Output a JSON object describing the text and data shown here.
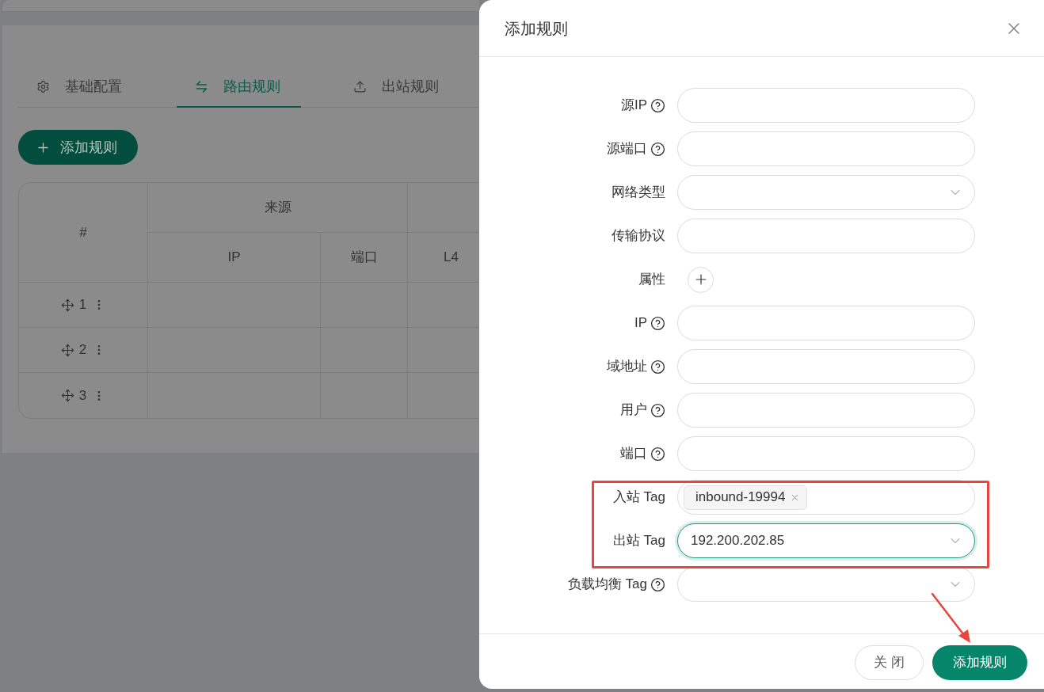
{
  "page": {
    "tabs": [
      {
        "label": "基础配置",
        "selected": false
      },
      {
        "label": "路由规则",
        "selected": true
      },
      {
        "label": "出站规则",
        "selected": false
      }
    ],
    "add_button": "添加规则",
    "table": {
      "group_headers": [
        "#",
        "来源"
      ],
      "columns": [
        "IP",
        "端口",
        "L4"
      ],
      "rows": [
        {
          "index": "1"
        },
        {
          "index": "2"
        },
        {
          "index": "3"
        }
      ]
    }
  },
  "dialog": {
    "title": "添加规则",
    "fields": [
      {
        "label": "源IP",
        "help": true,
        "kind": "input",
        "focused": false
      },
      {
        "label": "源端口",
        "help": true,
        "kind": "input",
        "focused": false
      },
      {
        "label": "网络类型",
        "help": false,
        "kind": "select",
        "focused": false
      },
      {
        "label": "传输协议",
        "help": false,
        "kind": "input",
        "focused": false
      },
      {
        "label": "属性",
        "help": false,
        "kind": "add"
      },
      {
        "label": "IP",
        "help": true,
        "kind": "input",
        "focused": false
      },
      {
        "label": "域地址",
        "help": true,
        "kind": "input",
        "focused": false
      },
      {
        "label": "用户",
        "help": true,
        "kind": "input",
        "focused": false
      },
      {
        "label": "端口",
        "help": true,
        "kind": "input",
        "focused": false
      },
      {
        "label": "入站 Tag",
        "help": false,
        "kind": "tags",
        "focused": false,
        "tags": [
          "inbound-19994"
        ]
      },
      {
        "label": "出站 Tag",
        "help": false,
        "kind": "select",
        "focused": true,
        "value": "192.200.202.85"
      },
      {
        "label": "负载均衡 Tag",
        "help": true,
        "kind": "select",
        "focused": false
      }
    ],
    "buttons": [
      {
        "label": "关 闭",
        "kind": "secondary"
      },
      {
        "label": "添加规则",
        "kind": "primary"
      }
    ]
  }
}
